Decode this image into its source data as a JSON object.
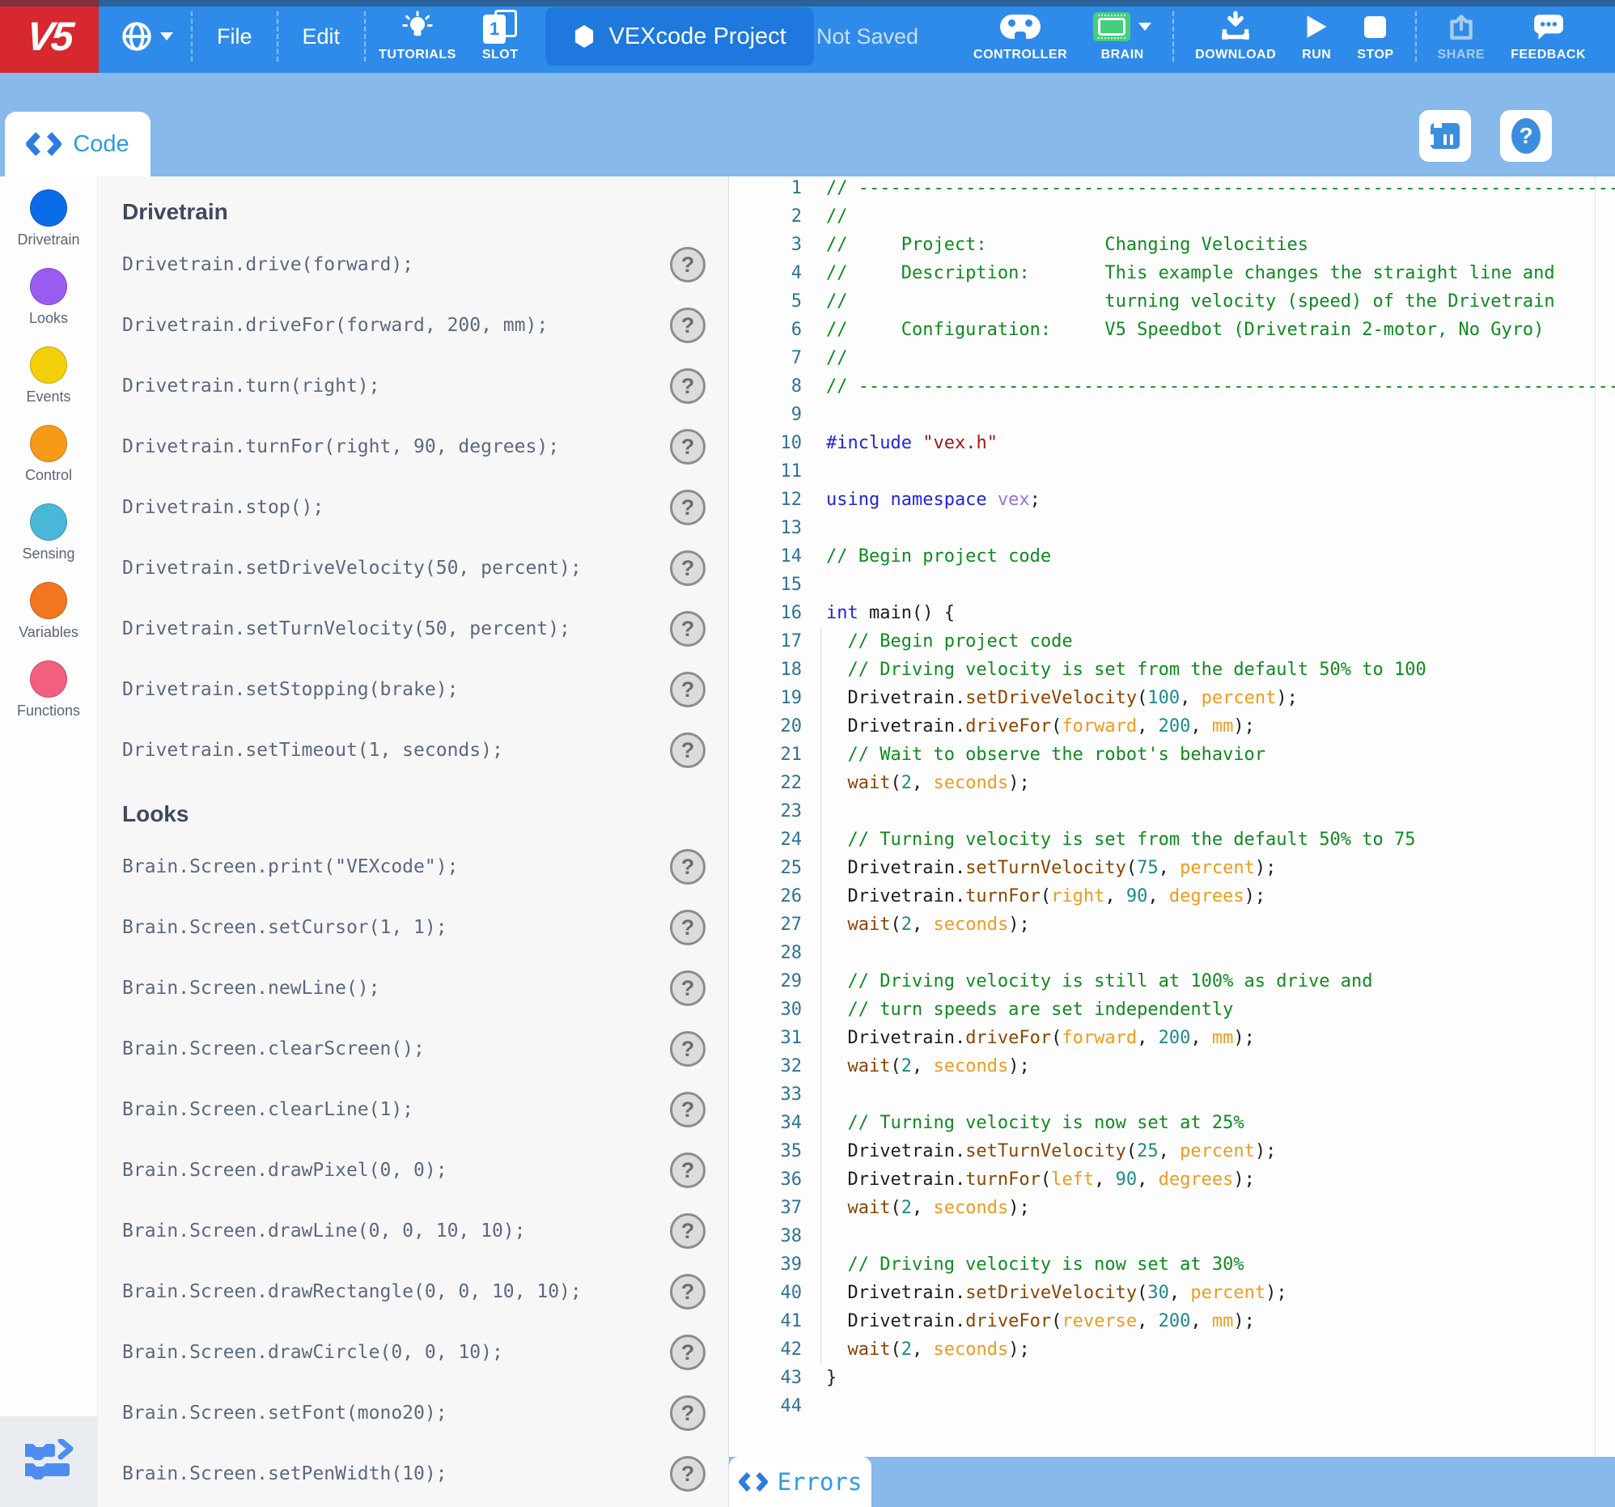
{
  "colors": {
    "topbar_blue": "#2f8be9",
    "logo_red": "#d7282f",
    "subbar_blue": "#87b9ea",
    "tab_text_blue": "#2e9ae4",
    "brain_green": "#43cf7c"
  },
  "icons": {
    "globe": "globe-icon",
    "tutorials": "lightbulb-icon",
    "slot": "pages-icon",
    "project": "hexagon-icon",
    "controller": "gamepad-icon",
    "brain": "brain-icon",
    "download": "download-arrow-icon",
    "run": "play-icon",
    "stop": "square-icon",
    "share": "share-icon",
    "feedback": "speech-bubble-icon",
    "code": "angle-brackets-icon",
    "device_tab": "brain-device-icon",
    "help_tab": "question-icon",
    "blocks": "blocks-to-text-icon"
  },
  "topbar": {
    "logo": "V5",
    "menu": [
      {
        "label": "File"
      },
      {
        "label": "Edit"
      }
    ],
    "tutorials_label": "TUTORIALS",
    "slot_label": "SLOT",
    "slot_number": "1",
    "project_name": "VEXcode Project",
    "save_status": "Not Saved",
    "controller_label": "CONTROLLER",
    "brain_label": "BRAIN",
    "download_label": "DOWNLOAD",
    "run_label": "RUN",
    "stop_label": "STOP",
    "share_label": "SHARE",
    "feedback_label": "FEEDBACK"
  },
  "tabs": {
    "code_label": "Code",
    "errors_label": "Errors"
  },
  "palette": {
    "help_glyph": "?",
    "categories": [
      {
        "label": "Drivetrain",
        "color": "#0a6ce8"
      },
      {
        "label": "Looks",
        "color": "#9a5cf0"
      },
      {
        "label": "Events",
        "color": "#f2cf08"
      },
      {
        "label": "Control",
        "color": "#f69a17"
      },
      {
        "label": "Sensing",
        "color": "#49b8d8"
      },
      {
        "label": "Variables",
        "color": "#f2761f"
      },
      {
        "label": "Functions",
        "color": "#f25f7f"
      }
    ],
    "sections": [
      {
        "header": "Drivetrain",
        "commands": [
          "Drivetrain.drive(forward);",
          "Drivetrain.driveFor(forward, 200, mm);",
          "Drivetrain.turn(right);",
          "Drivetrain.turnFor(right, 90, degrees);",
          "Drivetrain.stop();",
          "Drivetrain.setDriveVelocity(50, percent);",
          "Drivetrain.setTurnVelocity(50, percent);",
          "Drivetrain.setStopping(brake);",
          "Drivetrain.setTimeout(1, seconds);"
        ]
      },
      {
        "header": "Looks",
        "commands": [
          "Brain.Screen.print(\"VEXcode\");",
          "Brain.Screen.setCursor(1, 1);",
          "Brain.Screen.newLine();",
          "Brain.Screen.clearScreen();",
          "Brain.Screen.clearLine(1);",
          "Brain.Screen.drawPixel(0, 0);",
          "Brain.Screen.drawLine(0, 0, 10, 10);",
          "Brain.Screen.drawRectangle(0, 0, 10, 10);",
          "Brain.Screen.drawCircle(0, 0, 10);",
          "Brain.Screen.setFont(mono20);",
          "Brain.Screen.setPenWidth(10);"
        ]
      }
    ]
  },
  "editor": {
    "lines": [
      {
        "n": 1,
        "segs": [
          [
            "cm",
            "// --------------------------------------------------------------------------------"
          ]
        ]
      },
      {
        "n": 2,
        "segs": [
          [
            "cm",
            "//"
          ]
        ]
      },
      {
        "n": 3,
        "segs": [
          [
            "cm",
            "//     Project:           Changing Velocities"
          ]
        ]
      },
      {
        "n": 4,
        "segs": [
          [
            "cm",
            "//     Description:       This example changes the straight line and"
          ]
        ]
      },
      {
        "n": 5,
        "segs": [
          [
            "cm",
            "//                        turning velocity (speed) of the Drivetrain"
          ]
        ]
      },
      {
        "n": 6,
        "segs": [
          [
            "cm",
            "//     Configuration:     V5 Speedbot (Drivetrain 2-motor, No Gyro)"
          ]
        ]
      },
      {
        "n": 7,
        "segs": [
          [
            "cm",
            "//"
          ]
        ]
      },
      {
        "n": 8,
        "segs": [
          [
            "cm",
            "// --------------------------------------------------------------------------------"
          ]
        ]
      },
      {
        "n": 9,
        "segs": []
      },
      {
        "n": 10,
        "segs": [
          [
            "kw",
            "#include"
          ],
          [
            "pl",
            " "
          ],
          [
            "str",
            "\"vex.h\""
          ]
        ]
      },
      {
        "n": 11,
        "segs": []
      },
      {
        "n": 12,
        "segs": [
          [
            "kw",
            "using namespace "
          ],
          [
            "ns",
            "vex"
          ],
          [
            "pl",
            ";"
          ]
        ]
      },
      {
        "n": 13,
        "segs": []
      },
      {
        "n": 14,
        "segs": [
          [
            "cm",
            "// Begin project code"
          ]
        ]
      },
      {
        "n": 15,
        "segs": []
      },
      {
        "n": 16,
        "segs": [
          [
            "kw",
            "int"
          ],
          [
            "pl",
            " main() {"
          ]
        ]
      },
      {
        "n": 17,
        "segs": [
          [
            "cm",
            "  // Begin project code"
          ]
        ]
      },
      {
        "n": 18,
        "segs": [
          [
            "cm",
            "  // Driving velocity is set from the default 50% to 100"
          ]
        ]
      },
      {
        "n": 19,
        "segs": [
          [
            "pl",
            "  Drivetrain."
          ],
          [
            "fn",
            "setDriveVelocity"
          ],
          [
            "pl",
            "("
          ],
          [
            "num",
            "100"
          ],
          [
            "pl",
            ", "
          ],
          [
            "arg",
            "percent"
          ],
          [
            "pl",
            ");"
          ]
        ]
      },
      {
        "n": 20,
        "segs": [
          [
            "pl",
            "  Drivetrain."
          ],
          [
            "fn",
            "driveFor"
          ],
          [
            "pl",
            "("
          ],
          [
            "arg",
            "forward"
          ],
          [
            "pl",
            ", "
          ],
          [
            "num",
            "200"
          ],
          [
            "pl",
            ", "
          ],
          [
            "arg",
            "mm"
          ],
          [
            "pl",
            ");"
          ]
        ]
      },
      {
        "n": 21,
        "segs": [
          [
            "cm",
            "  // Wait to observe the robot's behavior"
          ]
        ]
      },
      {
        "n": 22,
        "segs": [
          [
            "pl",
            "  "
          ],
          [
            "fn",
            "wait"
          ],
          [
            "pl",
            "("
          ],
          [
            "num",
            "2"
          ],
          [
            "pl",
            ", "
          ],
          [
            "arg",
            "seconds"
          ],
          [
            "pl",
            ");"
          ]
        ]
      },
      {
        "n": 23,
        "segs": []
      },
      {
        "n": 24,
        "segs": [
          [
            "cm",
            "  // Turning velocity is set from the default 50% to 75"
          ]
        ]
      },
      {
        "n": 25,
        "segs": [
          [
            "pl",
            "  Drivetrain."
          ],
          [
            "fn",
            "setTurnVelocity"
          ],
          [
            "pl",
            "("
          ],
          [
            "num",
            "75"
          ],
          [
            "pl",
            ", "
          ],
          [
            "arg",
            "percent"
          ],
          [
            "pl",
            ");"
          ]
        ]
      },
      {
        "n": 26,
        "segs": [
          [
            "pl",
            "  Drivetrain."
          ],
          [
            "fn",
            "turnFor"
          ],
          [
            "pl",
            "("
          ],
          [
            "arg",
            "right"
          ],
          [
            "pl",
            ", "
          ],
          [
            "num",
            "90"
          ],
          [
            "pl",
            ", "
          ],
          [
            "arg",
            "degrees"
          ],
          [
            "pl",
            ");"
          ]
        ]
      },
      {
        "n": 27,
        "segs": [
          [
            "pl",
            "  "
          ],
          [
            "fn",
            "wait"
          ],
          [
            "pl",
            "("
          ],
          [
            "num",
            "2"
          ],
          [
            "pl",
            ", "
          ],
          [
            "arg",
            "seconds"
          ],
          [
            "pl",
            ");"
          ]
        ]
      },
      {
        "n": 28,
        "segs": []
      },
      {
        "n": 29,
        "segs": [
          [
            "cm",
            "  // Driving velocity is still at 100% as drive and"
          ]
        ]
      },
      {
        "n": 30,
        "segs": [
          [
            "cm",
            "  // turn speeds are set independently"
          ]
        ]
      },
      {
        "n": 31,
        "segs": [
          [
            "pl",
            "  Drivetrain."
          ],
          [
            "fn",
            "driveFor"
          ],
          [
            "pl",
            "("
          ],
          [
            "arg",
            "forward"
          ],
          [
            "pl",
            ", "
          ],
          [
            "num",
            "200"
          ],
          [
            "pl",
            ", "
          ],
          [
            "arg",
            "mm"
          ],
          [
            "pl",
            ");"
          ]
        ]
      },
      {
        "n": 32,
        "segs": [
          [
            "pl",
            "  "
          ],
          [
            "fn",
            "wait"
          ],
          [
            "pl",
            "("
          ],
          [
            "num",
            "2"
          ],
          [
            "pl",
            ", "
          ],
          [
            "arg",
            "seconds"
          ],
          [
            "pl",
            ");"
          ]
        ]
      },
      {
        "n": 33,
        "segs": []
      },
      {
        "n": 34,
        "segs": [
          [
            "cm",
            "  // Turning velocity is now set at 25%"
          ]
        ]
      },
      {
        "n": 35,
        "segs": [
          [
            "pl",
            "  Drivetrain."
          ],
          [
            "fn",
            "setTurnVelocity"
          ],
          [
            "pl",
            "("
          ],
          [
            "num",
            "25"
          ],
          [
            "pl",
            ", "
          ],
          [
            "arg",
            "percent"
          ],
          [
            "pl",
            ");"
          ]
        ]
      },
      {
        "n": 36,
        "segs": [
          [
            "pl",
            "  Drivetrain."
          ],
          [
            "fn",
            "turnFor"
          ],
          [
            "pl",
            "("
          ],
          [
            "arg",
            "left"
          ],
          [
            "pl",
            ", "
          ],
          [
            "num",
            "90"
          ],
          [
            "pl",
            ", "
          ],
          [
            "arg",
            "degrees"
          ],
          [
            "pl",
            ");"
          ]
        ]
      },
      {
        "n": 37,
        "segs": [
          [
            "pl",
            "  "
          ],
          [
            "fn",
            "wait"
          ],
          [
            "pl",
            "("
          ],
          [
            "num",
            "2"
          ],
          [
            "pl",
            ", "
          ],
          [
            "arg",
            "seconds"
          ],
          [
            "pl",
            ");"
          ]
        ]
      },
      {
        "n": 38,
        "segs": []
      },
      {
        "n": 39,
        "segs": [
          [
            "cm",
            "  // Driving velocity is now set at 30%"
          ]
        ]
      },
      {
        "n": 40,
        "segs": [
          [
            "pl",
            "  Drivetrain."
          ],
          [
            "fn",
            "setDriveVelocity"
          ],
          [
            "pl",
            "("
          ],
          [
            "num",
            "30"
          ],
          [
            "pl",
            ", "
          ],
          [
            "arg",
            "percent"
          ],
          [
            "pl",
            ");"
          ]
        ]
      },
      {
        "n": 41,
        "segs": [
          [
            "pl",
            "  Drivetrain."
          ],
          [
            "fn",
            "driveFor"
          ],
          [
            "pl",
            "("
          ],
          [
            "arg",
            "reverse"
          ],
          [
            "pl",
            ", "
          ],
          [
            "num",
            "200"
          ],
          [
            "pl",
            ", "
          ],
          [
            "arg",
            "mm"
          ],
          [
            "pl",
            ");"
          ]
        ]
      },
      {
        "n": 42,
        "segs": [
          [
            "pl",
            "  "
          ],
          [
            "fn",
            "wait"
          ],
          [
            "pl",
            "("
          ],
          [
            "num",
            "2"
          ],
          [
            "pl",
            ", "
          ],
          [
            "arg",
            "seconds"
          ],
          [
            "pl",
            ");"
          ]
        ]
      },
      {
        "n": 43,
        "segs": [
          [
            "pl",
            "}"
          ]
        ]
      },
      {
        "n": 44,
        "segs": []
      }
    ]
  }
}
